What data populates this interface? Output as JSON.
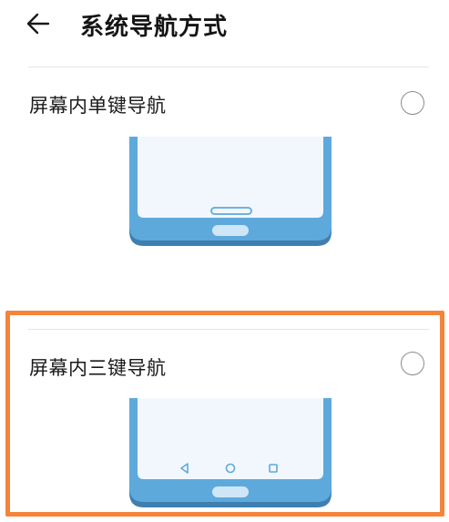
{
  "header": {
    "title": "系统导航方式",
    "back_icon": "arrow-left-icon"
  },
  "options": [
    {
      "label": "屏幕内单键导航",
      "selected": false,
      "preview_icons": [
        "home-bar-icon",
        "home-pill-icon"
      ]
    },
    {
      "label": "屏幕内三键导航",
      "selected": false,
      "preview_icons": [
        "back-triangle-icon",
        "home-circle-icon",
        "recents-square-icon",
        "home-pill-icon"
      ]
    }
  ],
  "colors": {
    "phone_body": "#5ea9dc",
    "phone_shadow": "#3f7fb0",
    "screen": "#f1f7fc",
    "icon_stroke": "#5ea9dc",
    "pill": "#cfe6f6",
    "highlight": "#f5843a",
    "radio_border": "#8c8c8c"
  }
}
